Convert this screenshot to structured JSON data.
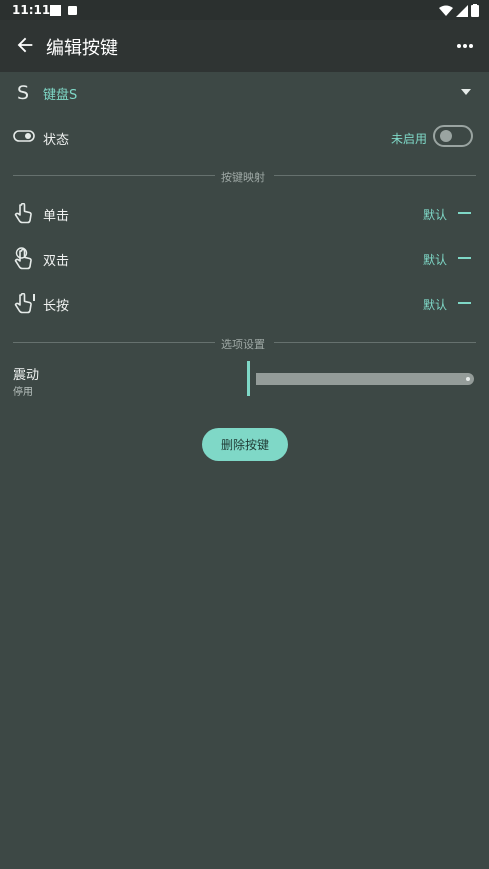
{
  "status_bar": {
    "time": "11:11"
  },
  "app_bar": {
    "title": "编辑按键"
  },
  "key_selector": {
    "icon_letter": "S",
    "value": "键盘S"
  },
  "state_row": {
    "label": "状态",
    "value": "未启用"
  },
  "sections": {
    "mapping": "按键映射",
    "options": "选项设置"
  },
  "mapping_rows": [
    {
      "label": "单击",
      "value": "默认"
    },
    {
      "label": "双击",
      "value": "默认"
    },
    {
      "label": "长按",
      "value": "默认"
    }
  ],
  "vibration": {
    "title": "震动",
    "subtitle": "停用"
  },
  "delete_button": {
    "label": "删除按键"
  },
  "colors": {
    "accent": "#7fd8c7",
    "background": "#3d4845",
    "app_bar": "#2f3433"
  }
}
